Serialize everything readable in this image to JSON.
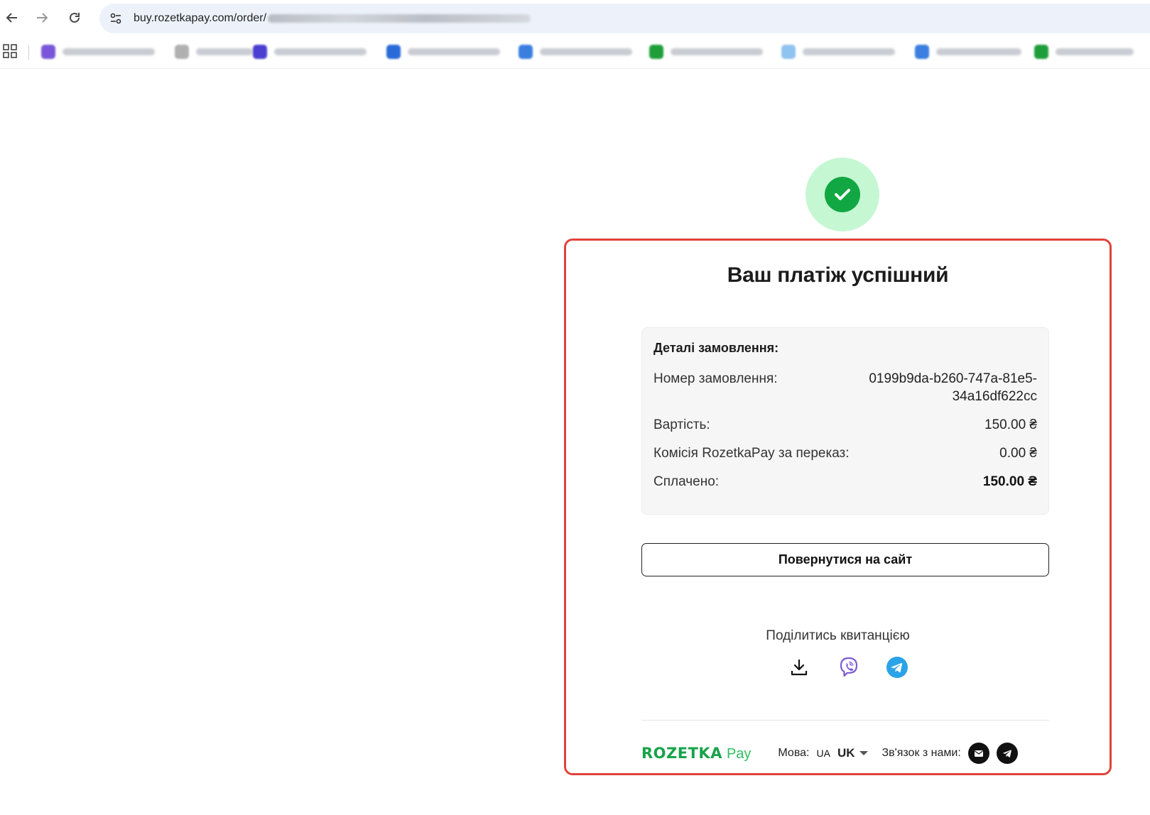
{
  "browser": {
    "url_visible": "buy.rozetkapay.com/order/",
    "bookmark_colors": [
      "#7a56d8",
      "#b0b0b0",
      "#4a3fd0",
      "#2a6ad8",
      "#3a7fe0",
      "#1e9e3a",
      "#8fc3f0",
      "#3a7fe0",
      "#1e9e3a"
    ]
  },
  "status": {
    "icon": "check-icon",
    "color": "#11a843",
    "ring_color": "#c6f7d3"
  },
  "card": {
    "title": "Ваш платіж успішний",
    "details_heading": "Деталі замовлення:",
    "rows": [
      {
        "label": "Номер замовлення:",
        "value": "0199b9da-b260-747a-81e5-34a16df622cc"
      },
      {
        "label": "Вартість:",
        "value": "150.00 ₴"
      },
      {
        "label": "Комісія RozetkaPay за переказ:",
        "value": "0.00 ₴"
      },
      {
        "label": "Сплачено:",
        "value": "150.00 ₴"
      }
    ],
    "return_button": "Повернутися на сайт",
    "share_label": "Поділитись квитанцією",
    "share_icons": [
      "download-icon",
      "viber-icon",
      "telegram-icon"
    ]
  },
  "footer": {
    "logo_main": "ROZETKA",
    "logo_sub": "Pay",
    "language_label": "Мова:",
    "language_flag": "UA",
    "language_code": "UK",
    "contact_label": "Зв'язок з нами:",
    "contact_icons": [
      "email-icon",
      "telegram-icon"
    ]
  },
  "colors": {
    "highlight_border": "#e0433b",
    "brand_green": "#17a34a",
    "viber": "#7d5bd6",
    "telegram": "#2aa3e8"
  }
}
